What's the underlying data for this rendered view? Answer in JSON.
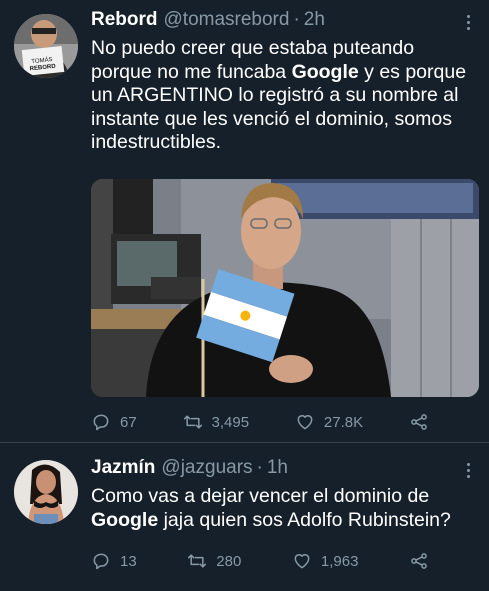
{
  "colors": {
    "background": "#15202b",
    "text": "#ffffff",
    "secondary": "#8899a6",
    "divider": "#38444d"
  },
  "tweets": [
    {
      "name": "Rebord",
      "handle": "@tomasrebord",
      "separator": "·",
      "time": "2h",
      "avatar_sign_text": "TOMÁS REBORD",
      "text_parts": [
        "No puedo creer que estaba puteando porque no me funcaba ",
        "Google",
        " y es porque un ARGENTINO lo registró a su nombre al instante que les venció el dominio, somos indestructibles."
      ],
      "media": "man in black sweater holding a small Argentine flag",
      "replies": "67",
      "retweets": "3,495",
      "likes": "27.8K"
    },
    {
      "name": "Jazmín",
      "handle": "@jazguars",
      "separator": "·",
      "time": "1h",
      "text_parts": [
        "Como vas a dejar vencer el dominio de ",
        "Google",
        " jaja quien sos Adolfo Rubinstein?"
      ],
      "replies": "13",
      "retweets": "280",
      "likes": "1,963"
    }
  ],
  "icons": {
    "reply": "reply-icon",
    "retweet": "retweet-icon",
    "like": "heart-icon",
    "share": "share-icon",
    "more": "more-options-icon"
  }
}
